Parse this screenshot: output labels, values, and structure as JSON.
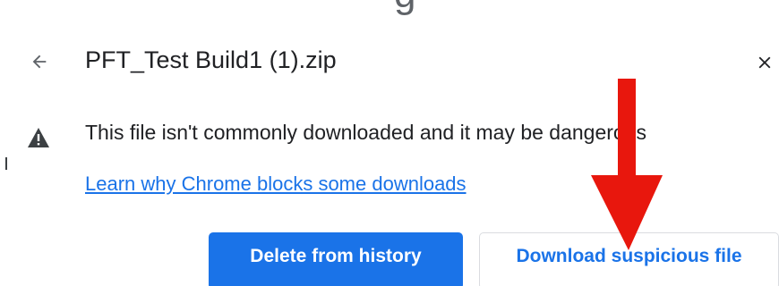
{
  "header": {
    "top_fragment": "g",
    "back_icon": "arrow-left-icon",
    "file_name": "PFT_Test Build1 (1).zip",
    "close_icon": "close-icon"
  },
  "warning": {
    "icon": "warning-triangle-icon",
    "message": "This file isn't commonly downloaded and it may be dangerous",
    "learn_link": "Learn why Chrome blocks some downloads"
  },
  "actions": {
    "delete_label": "Delete from history",
    "download_label": "Download suspicious file"
  },
  "colors": {
    "primary": "#1a73e8",
    "annotation_arrow": "#e8170d",
    "text": "#202124",
    "icon_gray": "#5f6368"
  }
}
